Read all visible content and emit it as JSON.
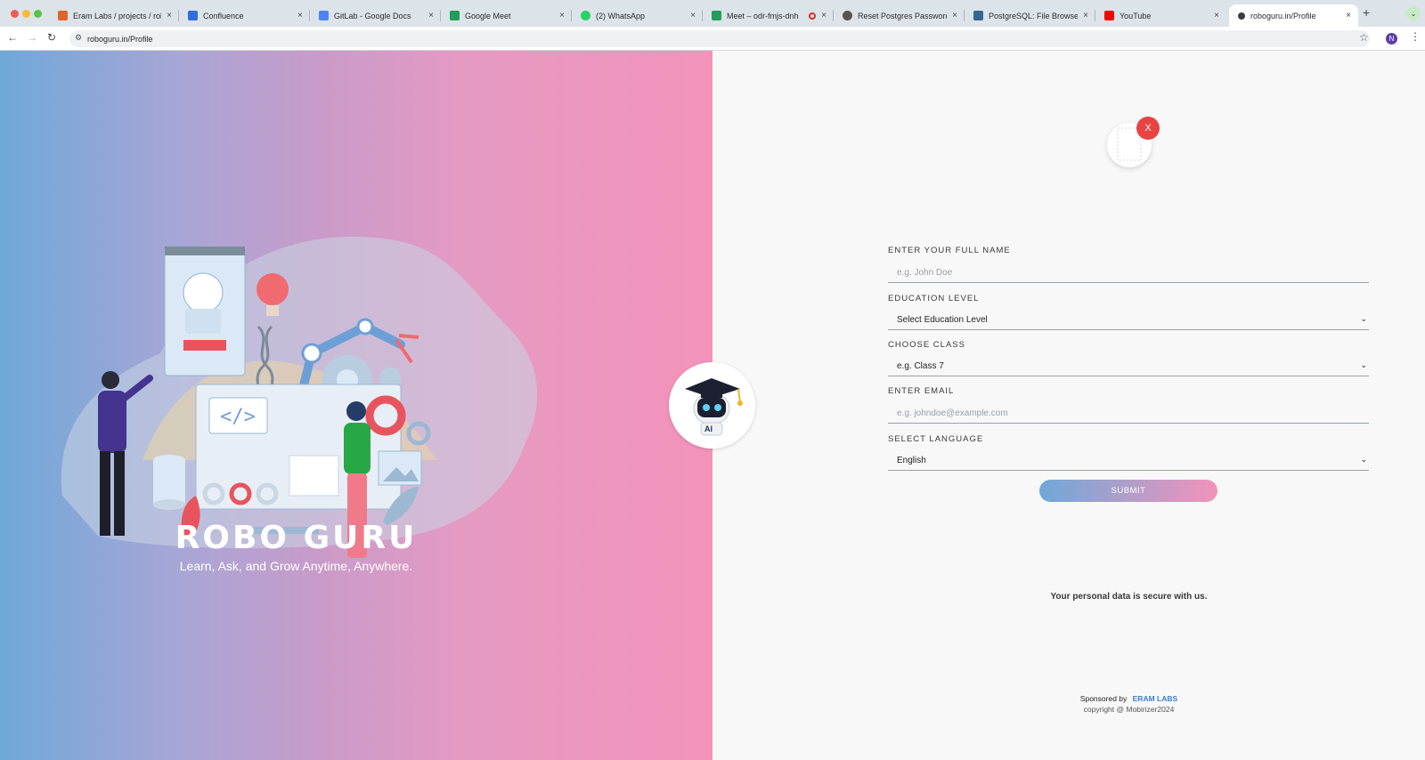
{
  "browser": {
    "tabs": [
      {
        "title": "Eram Labs / projects / robog...",
        "favicon_color": "#e2622b"
      },
      {
        "title": "Confluence",
        "favicon_color": "#2f6edb"
      },
      {
        "title": "GitLab - Google Docs",
        "favicon_color": "#4c84f2"
      },
      {
        "title": "Google Meet",
        "favicon_color": "#1f9d5b"
      },
      {
        "title": "(2) WhatsApp",
        "favicon_color": "#25d366"
      },
      {
        "title": "Meet – odr-fmjs-dnh",
        "favicon_color": "#1f9d5b"
      },
      {
        "title": "Reset Postgres Password Mo...",
        "favicon_color": "#555555"
      },
      {
        "title": "PostgreSQL: File Browser",
        "favicon_color": "#336791"
      },
      {
        "title": "YouTube",
        "favicon_color": "#ff0000"
      },
      {
        "title": "roboguru.in/Profile",
        "favicon_color": "#3c3c3c"
      }
    ],
    "close_glyph": "×",
    "newtab_glyph": "+",
    "url": "roboguru.in/Profile",
    "profile_initial": "N"
  },
  "hero": {
    "title": "ROBO GURU",
    "tagline": "Learn, Ask, and Grow Anytime, Anywhere."
  },
  "bot": {
    "badge": "AI"
  },
  "avatar": {
    "close": "X"
  },
  "form": {
    "name_label": "ENTER YOUR FULL NAME",
    "name_placeholder": "e.g. John Doe",
    "education_label": "EDUCATION LEVEL",
    "education_value": "Select Education Level",
    "class_label": "CHOOSE CLASS",
    "class_value": "e.g. Class 7",
    "email_label": "ENTER EMAIL",
    "email_placeholder": "e.g. johndoe@example.com",
    "language_label": "SELECT LANGUAGE",
    "language_value": "English",
    "submit_label": "SUBMIT"
  },
  "footer": {
    "secure_text": "Your personal data is secure with us.",
    "sponsored_by": "Sponsored by",
    "sponsor_name": "ERAM LABS",
    "copyright": "copyright @ Mobirizer2024"
  },
  "colors": {
    "gradient_start": "#6fa8d8",
    "gradient_end": "#f393bb",
    "close_red": "#e84343",
    "link_blue": "#3d7fd0"
  }
}
